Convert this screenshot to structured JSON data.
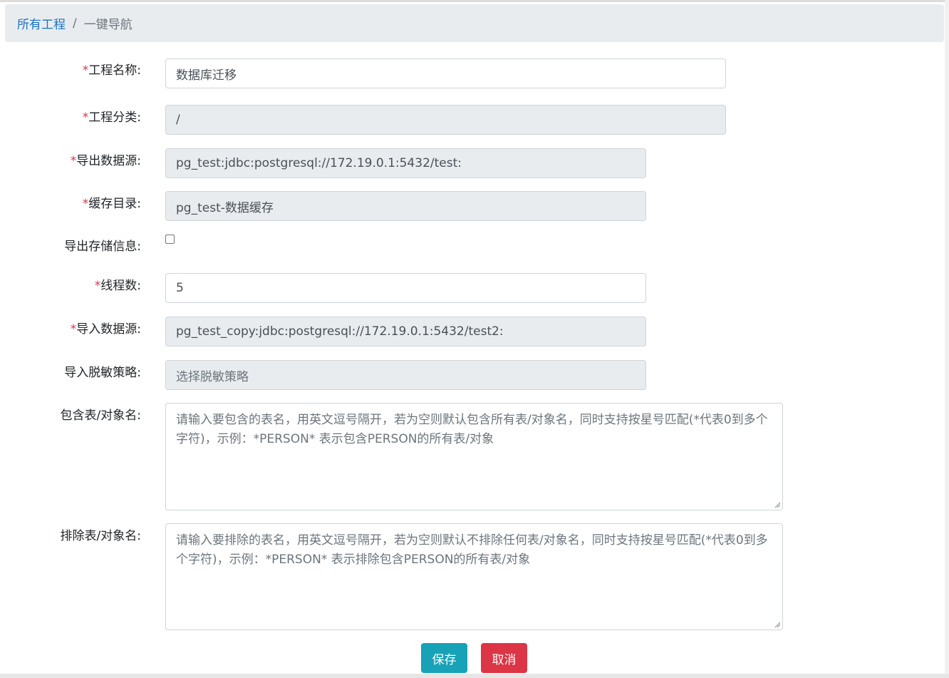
{
  "breadcrumb": {
    "root": "所有工程",
    "separator": "/",
    "current": "一键导航"
  },
  "form": {
    "project_name": {
      "label": "工程名称:",
      "value": "数据库迁移",
      "required": true
    },
    "project_category": {
      "label": "工程分类:",
      "value": "/",
      "required": true
    },
    "export_datasource": {
      "label": "导出数据源:",
      "value": "pg_test:jdbc:postgresql://172.19.0.1:5432/test:",
      "required": true
    },
    "cache_dir": {
      "label": "缓存目录:",
      "value": "pg_test-数据缓存",
      "required": true
    },
    "export_storage_info": {
      "label": "导出存储信息:",
      "checked": false
    },
    "threads": {
      "label": "线程数:",
      "value": "5",
      "required": true
    },
    "import_datasource": {
      "label": "导入数据源:",
      "value": "pg_test_copy:jdbc:postgresql://172.19.0.1:5432/test2:",
      "required": true
    },
    "import_masking": {
      "label": "导入脱敏策略:",
      "placeholder": "选择脱敏策略"
    },
    "include_tables": {
      "label": "包含表/对象名:",
      "placeholder": "请输入要包含的表名，用英文逗号隔开，若为空则默认包含所有表/对象名，同时支持按星号匹配(*代表0到多个字符)，示例：*PERSON* 表示包含PERSON的所有表/对象"
    },
    "exclude_tables": {
      "label": "排除表/对象名:",
      "placeholder": "请输入要排除的表名，用英文逗号隔开，若为空则默认不排除任何表/对象名，同时支持按星号匹配(*代表0到多个字符)，示例：*PERSON* 表示排除包含PERSON的所有表/对象"
    },
    "required_mark": "*"
  },
  "buttons": {
    "save": "保存",
    "cancel": "取消"
  },
  "colors": {
    "save": "#17a2b8",
    "cancel": "#dc3545",
    "link": "#1a73c8",
    "required": "#dc3545"
  }
}
